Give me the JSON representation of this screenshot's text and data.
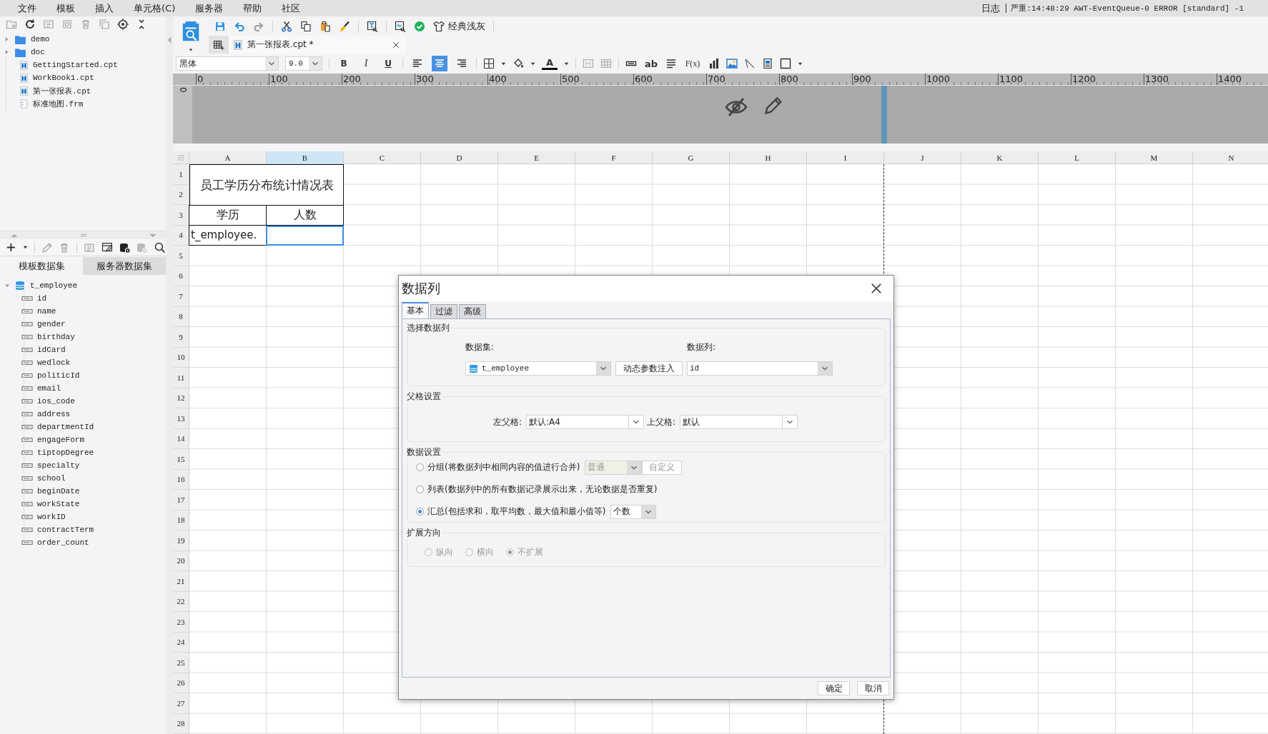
{
  "menu_bar": {
    "items": [
      "文件",
      "模板",
      "插入",
      "单元格(C)",
      "服务器",
      "帮助",
      "社区"
    ],
    "log_label": "日志",
    "log_message": "严重:14:48:29 AWT-EventQueue-0 ERROR [standard] -1"
  },
  "file_tree": {
    "items": [
      {
        "kind": "folder",
        "label": "demo",
        "expanded": false
      },
      {
        "kind": "folder",
        "label": "doc",
        "expanded": false
      },
      {
        "kind": "report",
        "label": "GettingStarted.cpt"
      },
      {
        "kind": "report",
        "label": "WorkBook1.cpt"
      },
      {
        "kind": "report",
        "label": "第一张报表.cpt"
      },
      {
        "kind": "form",
        "label": "标准地图.frm"
      }
    ]
  },
  "dataset_panel": {
    "tabs": [
      {
        "label": "模板数据集",
        "selected": true
      },
      {
        "label": "服务器数据集",
        "selected": false
      }
    ],
    "tree": {
      "label": "t_employee",
      "expanded": true,
      "children": [
        {
          "label": "id"
        },
        {
          "label": "name"
        },
        {
          "label": "gender"
        },
        {
          "label": "birthday"
        },
        {
          "label": "idCard"
        },
        {
          "label": "wedlock"
        },
        {
          "label": "politicId"
        },
        {
          "label": "email"
        },
        {
          "label": "ios_code"
        },
        {
          "label": "address"
        },
        {
          "label": "departmentId"
        },
        {
          "label": "engageForm"
        },
        {
          "label": "tiptopDegree"
        },
        {
          "label": "specialty"
        },
        {
          "label": "school"
        },
        {
          "label": "beginDate"
        },
        {
          "label": "workState"
        },
        {
          "label": "workID"
        },
        {
          "label": "contractTerm"
        },
        {
          "label": "order_count"
        }
      ]
    }
  },
  "designer_toolbar": {
    "theme_label": "经典浅灰"
  },
  "tabs": [
    {
      "label": "第一张报表.cpt *",
      "selected": true
    }
  ],
  "format_toolbar": {
    "items": [
      {
        "kind": "font",
        "value": "黑体"
      },
      {
        "kind": "size",
        "value": "9.0"
      },
      {
        "kind": "bold",
        "label": "B"
      },
      {
        "kind": "italic",
        "label": "I"
      },
      {
        "kind": "underline",
        "label": "U"
      },
      {
        "kind": "align-left",
        "selected": false
      },
      {
        "kind": "align-center",
        "selected": true
      },
      {
        "kind": "align-right",
        "selected": false
      },
      {
        "kind": "border"
      },
      {
        "kind": "fill"
      },
      {
        "kind": "font-color",
        "label": "A"
      },
      {
        "kind": "merge"
      },
      {
        "kind": "unmerge"
      },
      {
        "kind": "field"
      },
      {
        "kind": "text",
        "label": "ab"
      },
      {
        "kind": "paragraph"
      },
      {
        "kind": "formula",
        "label": "F(x)"
      },
      {
        "kind": "chart"
      },
      {
        "kind": "image"
      },
      {
        "kind": "slash"
      },
      {
        "kind": "sub-report"
      },
      {
        "kind": "frame"
      }
    ]
  },
  "ruler": {
    "labels": [
      "0",
      "100",
      "200",
      "300",
      "400",
      "500",
      "600",
      "700",
      "800",
      "900",
      "1000",
      "1100",
      "1200",
      "1300",
      "1400"
    ],
    "vertical_label": "0"
  },
  "sheet": {
    "columns": [
      {
        "label": "A",
        "selected": false
      },
      {
        "label": "B",
        "selected": true
      },
      {
        "label": "C",
        "selected": false
      },
      {
        "label": "D",
        "selected": false
      },
      {
        "label": "E",
        "selected": false
      },
      {
        "label": "F",
        "selected": false
      },
      {
        "label": "G",
        "selected": false
      },
      {
        "label": "H",
        "selected": false
      },
      {
        "label": "I",
        "selected": false
      },
      {
        "label": "J",
        "selected": false
      },
      {
        "label": "K",
        "selected": false
      },
      {
        "label": "L",
        "selected": false
      },
      {
        "label": "M",
        "selected": false
      },
      {
        "label": "N",
        "selected": false
      }
    ],
    "rows": [
      "1",
      "2",
      "3",
      "4",
      "5",
      "6",
      "7",
      "8",
      "9",
      "10",
      "11",
      "12",
      "13",
      "14",
      "15",
      "16",
      "17",
      "18",
      "19",
      "20",
      "21",
      "22",
      "23",
      "24",
      "25",
      "26",
      "27",
      "28"
    ],
    "title_cell": "员工学历分布统计情况表",
    "header_cells": [
      "学历",
      "人数"
    ],
    "data_cells": [
      {
        "text": "t_employee.",
        "selected": false
      },
      {
        "selected": true
      }
    ]
  },
  "dialog": {
    "title": "数据列",
    "tabs": [
      {
        "label": "基本",
        "selected": true
      },
      {
        "label": "过滤",
        "selected": false
      },
      {
        "label": "高级",
        "selected": false
      }
    ],
    "select_section": {
      "title": "选择数据列",
      "dataset_label": "数据集:",
      "dataset_value": "t_employee",
      "inject_button": "动态参数注入",
      "column_label": "数据列:",
      "column_value": "id"
    },
    "parent_section": {
      "title": "父格设置",
      "left_label": "左父格:",
      "left_value": "默认:A4",
      "top_label": "上父格:",
      "top_value": "默认"
    },
    "data_section": {
      "title": "数据设置",
      "options": [
        {
          "label": "分组(将数据列中相同内容的值进行合并)",
          "selected": false,
          "combo_value": "普通",
          "combo_disabled": true,
          "button": "自定义"
        },
        {
          "label": "列表(数据列中的所有数据记录展示出来，无论数据是否重复)",
          "selected": false
        },
        {
          "label": "汇总(包括求和，取平均数，最大值和最小值等)",
          "selected": true,
          "combo_value": "个数",
          "combo_disabled": false
        }
      ]
    },
    "expand_section": {
      "title": "扩展方向",
      "disabled": true,
      "options": [
        {
          "label": "纵向",
          "selected": false
        },
        {
          "label": "横向",
          "selected": false
        },
        {
          "label": "不扩展",
          "selected": true
        }
      ]
    },
    "buttons": [
      "确定",
      "取消"
    ]
  }
}
